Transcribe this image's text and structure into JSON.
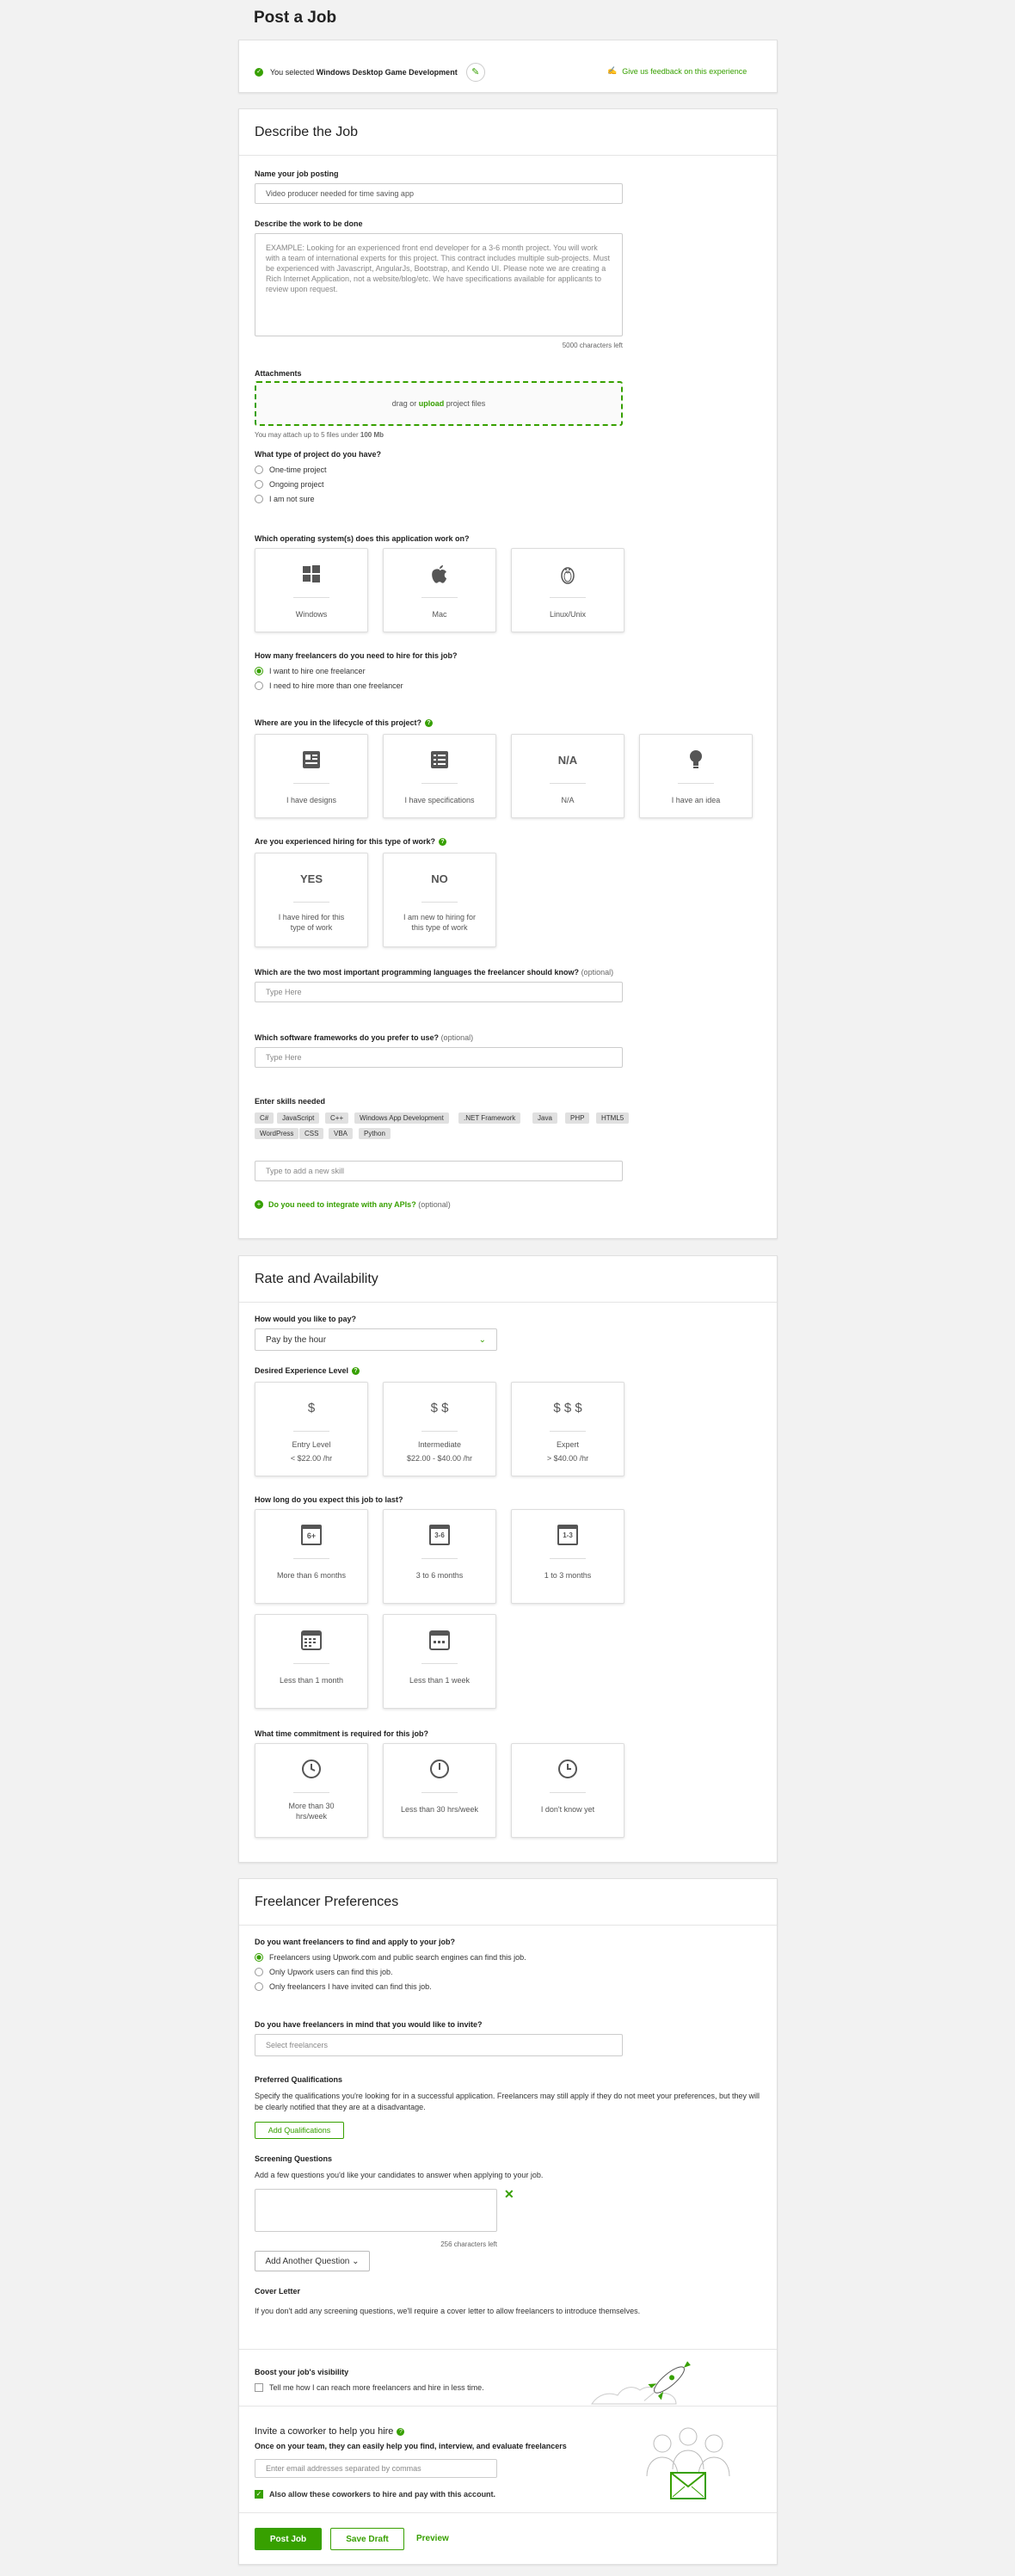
{
  "page_title": "Post a Job",
  "selection": {
    "prefix": "You selected",
    "category": "Windows Desktop Game Development",
    "feedback_link": "Give us feedback on this experience"
  },
  "describe": {
    "heading": "Describe the Job",
    "name_label": "Name your job posting",
    "name_value": "Video producer needed for time saving app",
    "work_label": "Describe the work to be done",
    "work_placeholder": "EXAMPLE: Looking for an experienced front end developer for a 3-6 month project. You will work with a team of international experts for this project. This contract includes multiple sub-projects. Must be experienced with Javascript, AngularJs, Bootstrap, and Kendo UI. Please note we are creating a Rich Internet Application, not a website/blog/etc. We have specifications available for applicants to review upon request.",
    "chars_left": "5000 characters left",
    "attach_label": "Attachments",
    "drop_prefix": "drag or",
    "drop_link": "upload",
    "drop_suffix": "project files",
    "attach_note_prefix": "You may attach up to 5 files under",
    "attach_note_size": "100 Mb",
    "project_type_label": "What type of project do you have?",
    "project_types": [
      "One-time project",
      "Ongoing project",
      "I am not sure"
    ],
    "os_label": "Which operating system(s) does this application work on?",
    "os_tiles": [
      "Windows",
      "Mac",
      "Linux/Unix"
    ],
    "hire_label": "How many freelancers do you need to hire for this job?",
    "hire_options": [
      "I want to hire one freelancer",
      "I need to hire more than one freelancer"
    ],
    "lifecycle_label": "Where are you in the lifecycle of this project?",
    "lifecycle_tiles": [
      "I have designs",
      "I have specifications",
      "N/A",
      "I have an idea"
    ],
    "lifecycle_na_icon": "N/A",
    "experienced_label": "Are you experienced hiring for this type of work?",
    "experienced_tiles": [
      {
        "icon": "YES",
        "text": "I have hired for this type of work"
      },
      {
        "icon": "NO",
        "text": "I am new to hiring for this type of work"
      }
    ],
    "langs_label": "Which are the two most important programming languages the freelancer should know?",
    "optional": "(optional)",
    "langs_placeholder": "Type Here",
    "frameworks_label": "Which software frameworks do you prefer to use?",
    "frameworks_placeholder": "Type Here",
    "skills_label": "Enter skills needed",
    "skills": [
      "C#",
      "JavaScript",
      "C++",
      "Windows App Development",
      ".NET Framework",
      "Java",
      "PHP",
      "HTML5",
      "WordPress",
      "CSS",
      "VBA",
      "Python"
    ],
    "skill_placeholder": "Type to add a new skill",
    "apis_link": "Do you need to integrate with any APIs?"
  },
  "rate": {
    "heading": "Rate and Availability",
    "pay_label": "How would you like to pay?",
    "pay_value": "Pay by the hour",
    "exp_label": "Desired Experience Level",
    "exp_tiles": [
      {
        "icon": "$",
        "name": "Entry Level",
        "rate": "< $22.00 /hr"
      },
      {
        "icon": "$ $",
        "name": "Intermediate",
        "rate": "$22.00 - $40.00 /hr"
      },
      {
        "icon": "$ $ $",
        "name": "Expert",
        "rate": "> $40.00 /hr"
      }
    ],
    "duration_label": "How long do you expect this job to last?",
    "duration_tiles": [
      {
        "icon": "6+",
        "text": "More than 6 months"
      },
      {
        "icon": "3-6",
        "text": "3 to 6 months"
      },
      {
        "icon": "1-3",
        "text": "1 to 3 months"
      },
      {
        "icon": "",
        "text": "Less than 1 month"
      },
      {
        "icon": "",
        "text": "Less than 1 week"
      }
    ],
    "commit_label": "What time commitment is required for this job?",
    "commit_tiles": [
      "More than 30 hrs/week",
      "Less than 30 hrs/week",
      "I don't know yet"
    ]
  },
  "prefs": {
    "heading": "Freelancer Preferences",
    "visibility_label": "Do you want freelancers to find and apply to your job?",
    "visibility_options": [
      "Freelancers using Upwork.com and public search engines can find this job.",
      "Only Upwork users can find this job.",
      "Only freelancers I have invited can find this job."
    ],
    "invite_label": "Do you have freelancers in mind that you would like to invite?",
    "invite_placeholder": "Select freelancers",
    "quals_label": "Preferred Qualifications",
    "quals_text": "Specify the qualifications you're looking for in a successful application. Freelancers may still apply if they do not meet your preferences, but they will be clearly notified that they are at a disadvantage.",
    "quals_button": "Add Qualifications",
    "screening_label": "Screening Questions",
    "screening_text": "Add a few questions you'd like your candidates to answer when applying to your job.",
    "screening_chars": "256 characters left",
    "add_question": "Add Another Question",
    "cover_label": "Cover Letter",
    "cover_text": "If you don't add any screening questions, we'll require a cover letter to allow freelancers to introduce themselves.",
    "boost_label": "Boost your job's visibility",
    "boost_option": "Tell me how I can reach more freelancers and hire in less time.",
    "coworker_title": "Invite a coworker to help you hire",
    "coworker_sub": "Once on your team, they can easily help you find, interview, and evaluate freelancers",
    "coworker_placeholder": "Enter email addresses separated by commas",
    "coworker_option": "Also allow these coworkers to hire and pay with this account."
  },
  "actions": {
    "post": "Post Job",
    "draft": "Save Draft",
    "preview": "Preview"
  },
  "colors": {
    "accent": "#37a000",
    "background": "#f2f2f2"
  }
}
